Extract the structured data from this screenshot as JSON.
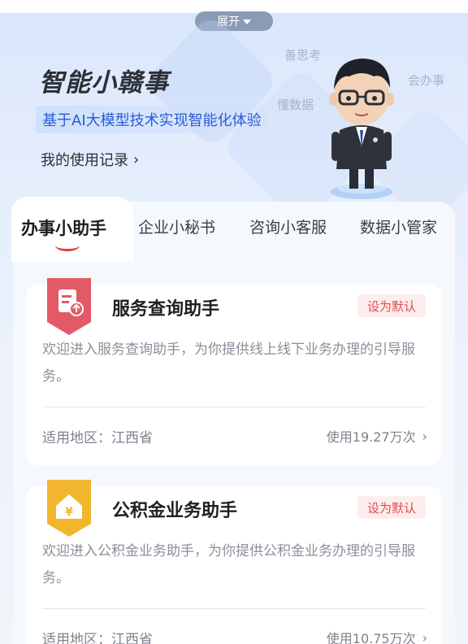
{
  "topbar": {
    "expand_label": "展开"
  },
  "hero": {
    "title": "智能小赣事",
    "subtitle": "基于AI大模型技术实现智能化体验",
    "record_link": "我的使用记录",
    "floating_tags": [
      "善思考",
      "会办事",
      "懂数据"
    ]
  },
  "tabs": [
    {
      "label": "办事小助手",
      "active": true
    },
    {
      "label": "企业小秘书",
      "active": false
    },
    {
      "label": "咨询小客服",
      "active": false
    },
    {
      "label": "数据小管家",
      "active": false
    }
  ],
  "cards": [
    {
      "icon": "document-upload-icon",
      "title": "服务查询助手",
      "badge": "设为默认",
      "description": "欢迎进入服务查询助手，为你提供线上线下业务办理的引导服务。",
      "region": "适用地区：江西省",
      "usage": "使用19.27万次"
    },
    {
      "icon": "house-yuan-icon",
      "title": "公积金业务助手",
      "badge": "设为默认",
      "description": "欢迎进入公积金业务助手，为你提供公积金业务办理的引导服务。",
      "region": "适用地区：江西省",
      "usage": "使用10.75万次"
    }
  ],
  "colors": {
    "accent_blue": "#2a5bd7",
    "accent_red": "#e5383e",
    "icon_red": "#e25a66",
    "icon_gold": "#f2b62e"
  }
}
